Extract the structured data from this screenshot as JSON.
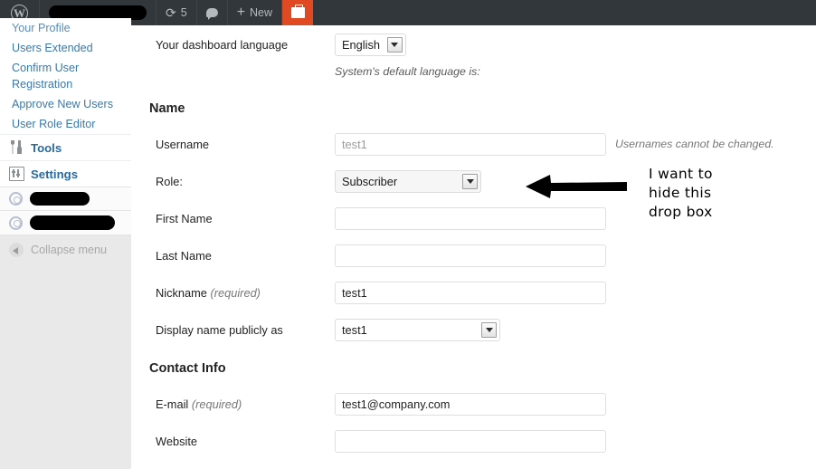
{
  "adminbar": {
    "logo_icon": "wordpress-logo-icon",
    "site_name_redacted": "",
    "updates_icon": "refresh-icon",
    "updates_count": "5",
    "comments_icon": "comment-bubble-icon",
    "new_icon": "plus-icon",
    "new_label": "New",
    "toolbox_icon": "briefcase-icon",
    "accent_orange": "#e04a23",
    "bar_background": "#32373c"
  },
  "sidebar": {
    "submenu": [
      {
        "label": "Your Profile",
        "clipped": true
      },
      {
        "label": "Users Extended",
        "clipped": false
      },
      {
        "label": "Confirm User Registration",
        "clipped": false
      },
      {
        "label": "Approve New Users",
        "clipped": false
      },
      {
        "label": "User Role Editor",
        "clipped": false
      }
    ],
    "top_items": [
      {
        "label": "Tools",
        "icon": "tools-icon"
      },
      {
        "label": "Settings",
        "icon": "settings-sliders-icon"
      }
    ],
    "redacted_items": [
      {
        "icon": "gear-icon",
        "label": ""
      },
      {
        "icon": "gear-icon",
        "label": ""
      }
    ],
    "collapse": {
      "label": "Collapse menu",
      "icon": "collapse-arrow-icon"
    },
    "link_color": "#3e78a7"
  },
  "form": {
    "language": {
      "label": "Your dashboard language",
      "value": "English",
      "note": "System's default language is:"
    },
    "name_heading": "Name",
    "username": {
      "label": "Username",
      "value": "test1",
      "hint": "Usernames cannot be changed."
    },
    "role": {
      "label": "Role:",
      "value": "Subscriber"
    },
    "first_name": {
      "label": "First Name",
      "value": "",
      "placeholder": ""
    },
    "last_name": {
      "label": "Last Name",
      "value": "",
      "placeholder": ""
    },
    "nickname": {
      "label": "Nickname",
      "required_tag": "(required)",
      "value": "test1"
    },
    "display_name": {
      "label": "Display name publicly as",
      "value": "test1"
    },
    "contact_heading": "Contact Info",
    "email": {
      "label": "E-mail",
      "required_tag": "(required)",
      "value": "test1@company.com"
    },
    "website": {
      "label": "Website",
      "value": "",
      "placeholder": ""
    }
  },
  "annotation": {
    "arrow_icon": "left-arrow-annotation",
    "line1": "I want to",
    "line2": "hide this",
    "line3": "drop box"
  }
}
